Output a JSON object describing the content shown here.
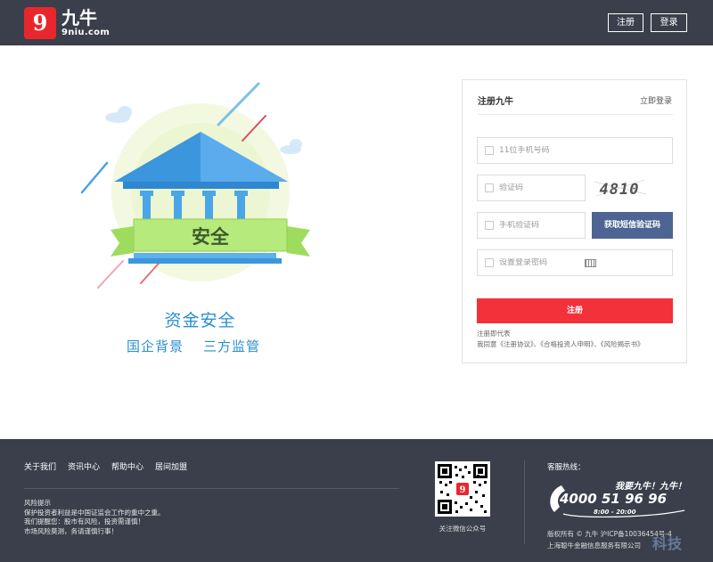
{
  "header": {
    "logo_char": "9",
    "logo_cn": "九牛",
    "logo_en": "9niu.com",
    "register_label": "注册",
    "login_label": "登录"
  },
  "illustration": {
    "banner_text": "安全",
    "slogan_main": "资金安全",
    "slogan_left": "国企背景",
    "slogan_right": "三方监管"
  },
  "form": {
    "title": "注册九牛",
    "login_link": "立即登录",
    "phone_placeholder": "11位手机号码",
    "captcha_placeholder": "验证码",
    "captcha_text": "4810",
    "sms_placeholder": "手机验证码",
    "sms_button": "获取短信验证码",
    "password_placeholder": "设置登录密码",
    "submit_label": "注册",
    "agree_line1": "注册即代表",
    "agree_line2": "我同意《注册协议》、《合格投资人申明》、《风险揭示书》"
  },
  "footer": {
    "nav": [
      "关于我们",
      "资讯中心",
      "帮助中心",
      "居间加盟"
    ],
    "risk_title": "风险提示",
    "risk_lines": [
      "保护投资者利益是中国证监会工作的重中之重。",
      "我们提醒您：股市有风险，投资需谨慎！",
      "市场风险莫测，务请谨慎行事！"
    ],
    "qr_caption": "关注微信公众号",
    "hotline_title": "客服热线：",
    "hotline_slogan": "我要九牛！九牛！",
    "hotline_number": "4000 51 96 96",
    "hotline_hours": "8:00 - 20:00",
    "copyright_line1": "版权所有 © 九牛 沪ICP备10036454号-4",
    "copyright_line2": "上海聪牛金融信息服务有限公司",
    "watermark": "科技"
  },
  "colors": {
    "header_bg": "#3a3f4b",
    "brand_red": "#e8272d",
    "submit_red": "#f2313a",
    "sms_button_bg": "#4e6593",
    "slogan_blue": "#2b8fcf"
  }
}
